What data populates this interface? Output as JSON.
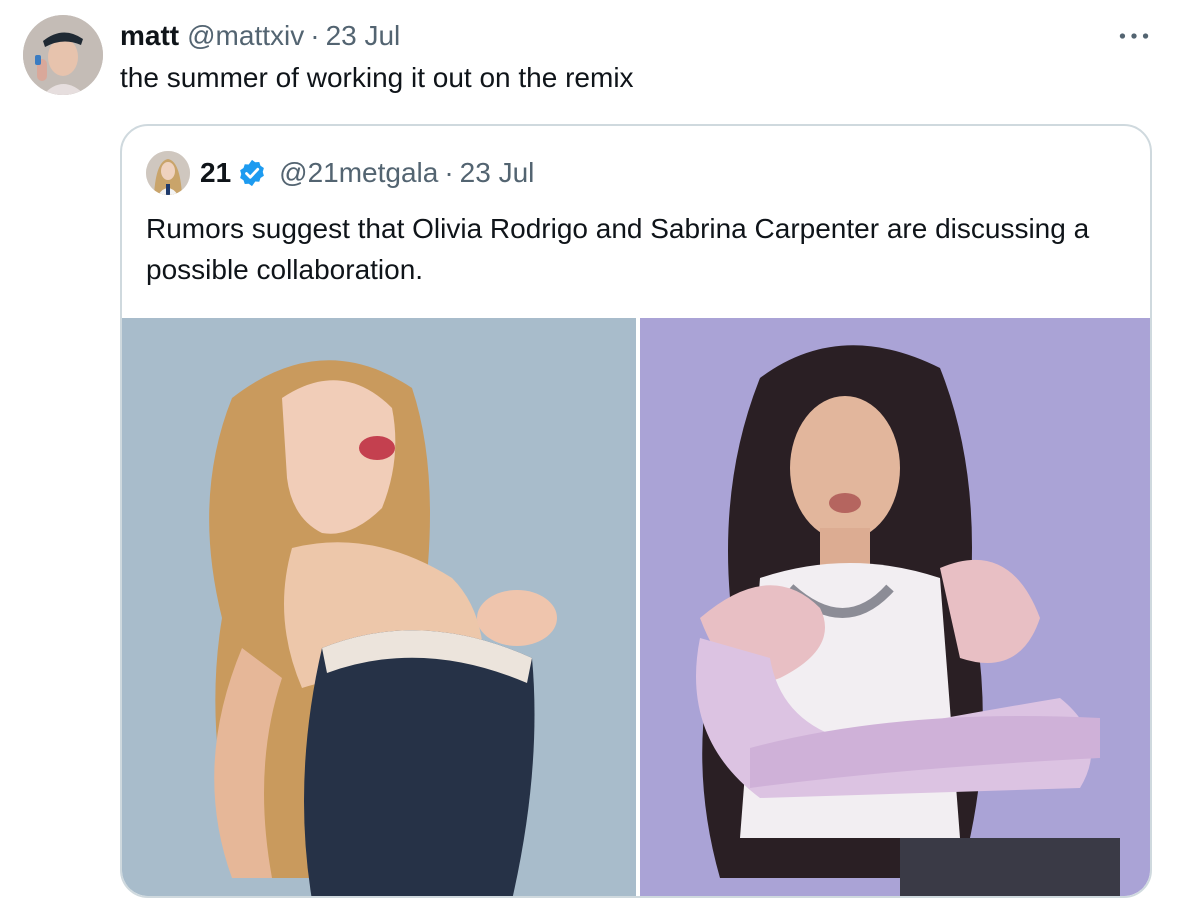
{
  "tweet": {
    "author": {
      "display_name": "matt",
      "handle": "@mattxiv"
    },
    "separator": "·",
    "date": "23 Jul",
    "text": "the summer of working it out on the remix",
    "more_icon": "more-horizontal-icon"
  },
  "quoted_tweet": {
    "author": {
      "display_name": "21",
      "handle": "@21metgala",
      "verified": true
    },
    "separator": "·",
    "date": "23 Jul",
    "text": "Rumors suggest that Olivia Rodrigo and Sabrina Carpenter are discussing a possible collaboration.",
    "verified_icon": "verified-badge-icon",
    "verified_color": "#1d9bf0"
  },
  "colors": {
    "text_primary": "#0f1419",
    "text_secondary": "#536471",
    "border": "#cfd9de"
  }
}
